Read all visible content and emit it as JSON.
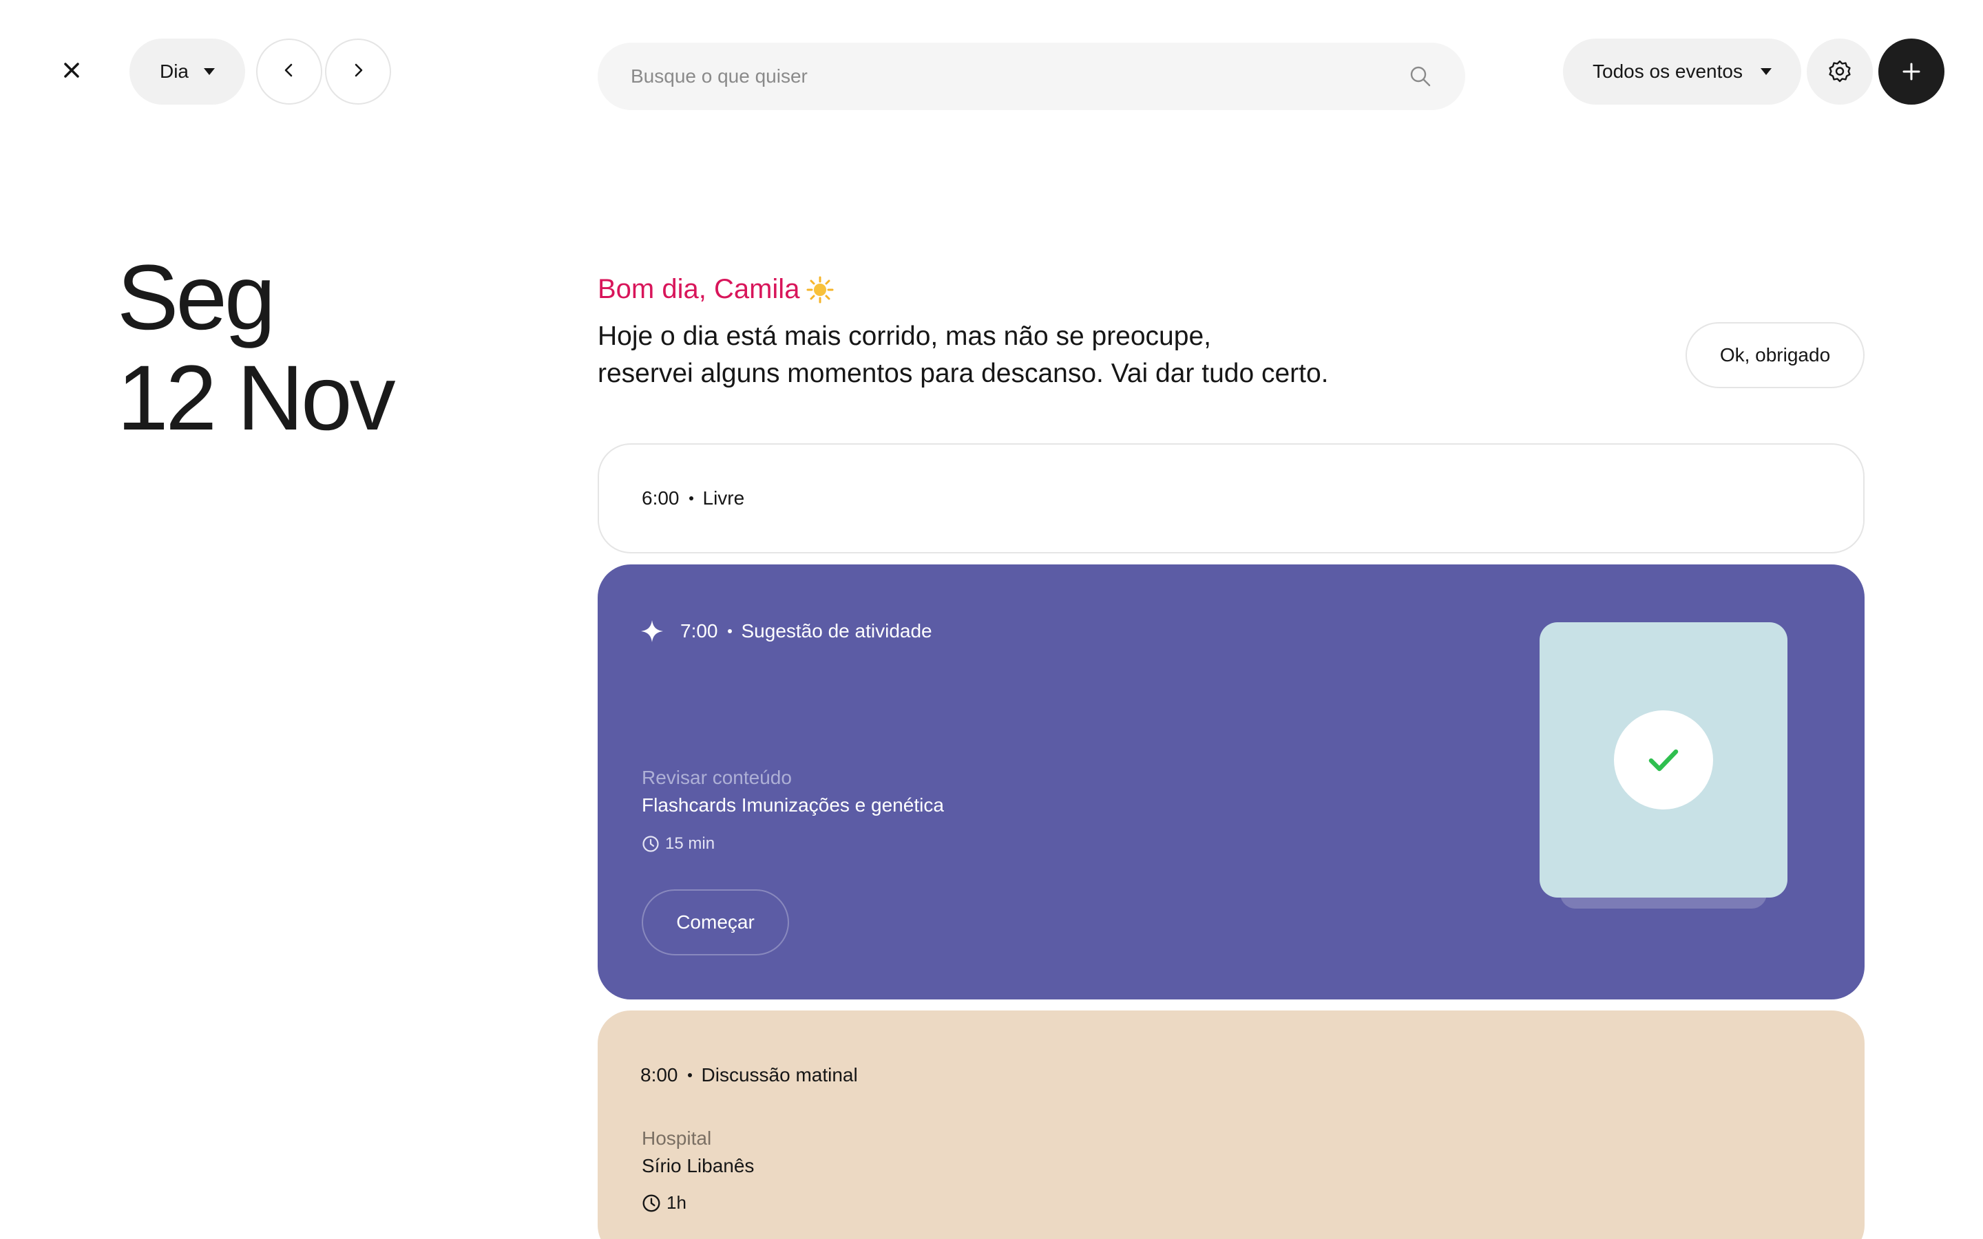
{
  "toolbar": {
    "close_icon": "close-icon",
    "view_label": "Dia",
    "prev_icon": "chevron-left-icon",
    "next_icon": "chevron-right-icon",
    "search_placeholder": "Busque o que quiser",
    "search_value": "",
    "filter_label": "Todos os eventos",
    "settings_icon": "gear-icon",
    "add_icon": "plus-icon"
  },
  "date": {
    "weekday": "Seg",
    "day_month": "12 Nov"
  },
  "greeting": {
    "title": "Bom dia, Camila",
    "title_icon": "sun-icon",
    "line1": "Hoje o dia está mais corrido, mas não se preocupe,",
    "line2": "reservei alguns momentos para descanso. Vai dar tudo certo.",
    "ok_label": "Ok, obrigado"
  },
  "events": {
    "free": {
      "time": "6:00",
      "label": "Livre"
    },
    "suggestion": {
      "icon": "sparkle-icon",
      "time": "7:00",
      "label": "Sugestão de atividade",
      "category": "Revisar conteúdo",
      "title": "Flashcards Imunizações e genética",
      "duration": "15 min",
      "start_label": "Começar",
      "illustration": "flashcard-check-icon"
    },
    "meeting": {
      "time": "8:00",
      "label": "Discussão matinal",
      "place_label": "Hospital",
      "place": "Sírio Libanês",
      "duration": "1h"
    }
  },
  "colors": {
    "accent": "#d8155a",
    "suggestion_bg": "#5c5ca5",
    "meeting_bg": "#ecd9c3",
    "check": "#2fbf4f",
    "dark_button": "#1d1d1d"
  }
}
